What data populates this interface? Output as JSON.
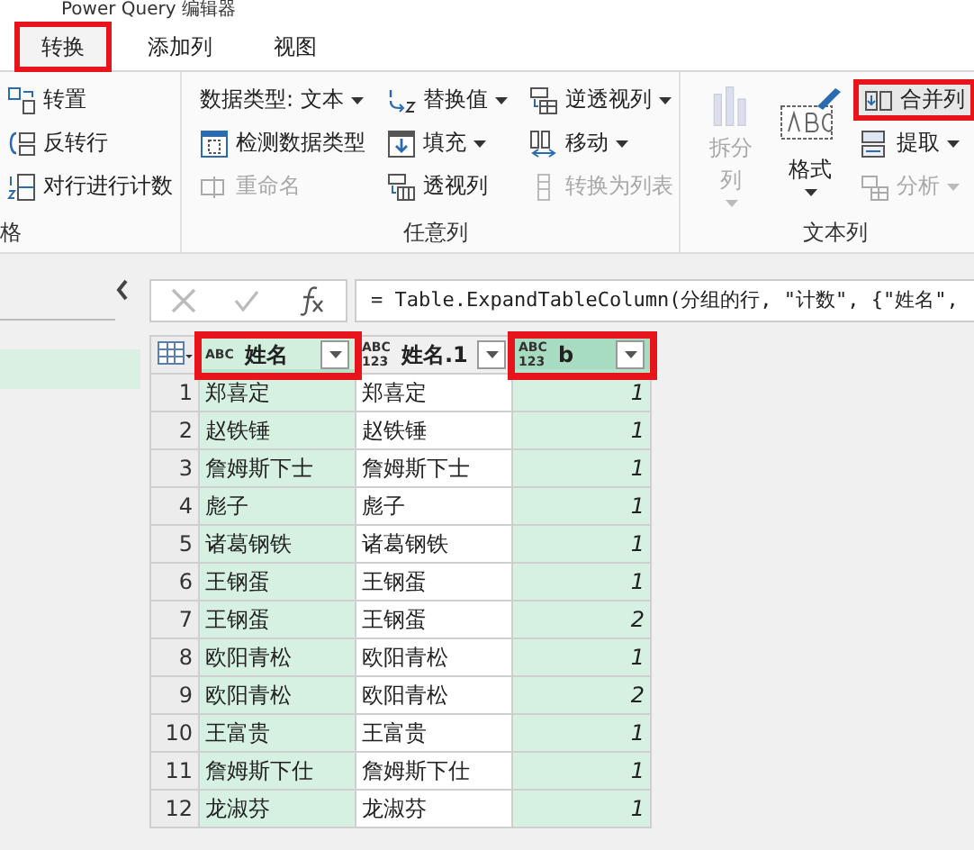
{
  "window": {
    "title": "Power Query 编辑器"
  },
  "tabs": [
    {
      "label": "转换",
      "selected": true,
      "highlighted": true
    },
    {
      "label": "添加列",
      "selected": false,
      "highlighted": false
    },
    {
      "label": "视图",
      "selected": false,
      "highlighted": false
    }
  ],
  "ribbon": {
    "groups": [
      {
        "label": "格",
        "columns": [
          {
            "kind": "small",
            "items": [
              {
                "label": "转置",
                "disabled": false,
                "dropdown": false,
                "highlighted": false
              },
              {
                "label": "反转行",
                "disabled": false,
                "dropdown": false,
                "highlighted": false
              },
              {
                "label": "对行进行计数",
                "disabled": false,
                "dropdown": false,
                "highlighted": false
              }
            ]
          }
        ]
      },
      {
        "label": "任意列",
        "columns": [
          {
            "kind": "small",
            "items": [
              {
                "label": "数据类型: 文本",
                "disabled": false,
                "dropdown": true,
                "highlighted": false
              },
              {
                "label": "检测数据类型",
                "disabled": false,
                "dropdown": false,
                "highlighted": false
              },
              {
                "label": "重命名",
                "disabled": true,
                "dropdown": false,
                "highlighted": false
              }
            ]
          },
          {
            "kind": "small",
            "items": [
              {
                "label": "替换值",
                "disabled": false,
                "dropdown": true,
                "highlighted": false
              },
              {
                "label": "填充",
                "disabled": false,
                "dropdown": true,
                "highlighted": false
              },
              {
                "label": "透视列",
                "disabled": false,
                "dropdown": false,
                "highlighted": false
              }
            ]
          },
          {
            "kind": "small",
            "items": [
              {
                "label": "逆透视列",
                "disabled": false,
                "dropdown": true,
                "highlighted": false
              },
              {
                "label": "移动",
                "disabled": false,
                "dropdown": true,
                "highlighted": false
              },
              {
                "label": "转换为列表",
                "disabled": true,
                "dropdown": false,
                "highlighted": false
              }
            ]
          }
        ]
      },
      {
        "label": "文本列",
        "columns": [
          {
            "kind": "large",
            "items": [
              {
                "label": "拆分列",
                "disabled": true,
                "dropdown": true,
                "highlighted": false
              }
            ]
          },
          {
            "kind": "large",
            "items": [
              {
                "label": "格式",
                "disabled": false,
                "dropdown": true,
                "highlighted": false
              }
            ]
          },
          {
            "kind": "small",
            "items": [
              {
                "label": "合并列",
                "disabled": false,
                "dropdown": false,
                "highlighted": true
              },
              {
                "label": "提取",
                "disabled": false,
                "dropdown": true,
                "highlighted": false
              },
              {
                "label": "分析",
                "disabled": true,
                "dropdown": true,
                "highlighted": false
              }
            ]
          }
        ]
      }
    ]
  },
  "queries": [
    {
      "selected": true
    }
  ],
  "formula_bar": {
    "formula": "= Table.ExpandTableColumn(分组的行, \"计数\", {\"姓名\","
  },
  "table": {
    "columns": [
      {
        "name": "姓名",
        "kind": "text",
        "type_label": "ABC",
        "selected": true,
        "focused": false,
        "highlighted": true
      },
      {
        "name": "姓名.1",
        "kind": "text",
        "type_label": "ABC 123",
        "selected": false,
        "focused": false,
        "highlighted": false
      },
      {
        "name": "b",
        "kind": "number",
        "type_label": "ABC 123",
        "selected": true,
        "focused": true,
        "highlighted": true
      }
    ],
    "rows": [
      {
        "number": "1",
        "cells": [
          "郑喜定",
          "郑喜定",
          "1"
        ]
      },
      {
        "number": "2",
        "cells": [
          "赵铁锤",
          "赵铁锤",
          "1"
        ]
      },
      {
        "number": "3",
        "cells": [
          "詹姆斯下士",
          "詹姆斯下士",
          "1"
        ]
      },
      {
        "number": "4",
        "cells": [
          "彪子",
          "彪子",
          "1"
        ]
      },
      {
        "number": "5",
        "cells": [
          "诸葛钢铁",
          "诸葛钢铁",
          "1"
        ]
      },
      {
        "number": "6",
        "cells": [
          "王钢蛋",
          "王钢蛋",
          "1"
        ]
      },
      {
        "number": "7",
        "cells": [
          "王钢蛋",
          "王钢蛋",
          "2"
        ]
      },
      {
        "number": "8",
        "cells": [
          "欧阳青松",
          "欧阳青松",
          "1"
        ]
      },
      {
        "number": "9",
        "cells": [
          "欧阳青松",
          "欧阳青松",
          "2"
        ]
      },
      {
        "number": "10",
        "cells": [
          "王富贵",
          "王富贵",
          "1"
        ]
      },
      {
        "number": "11",
        "cells": [
          "詹姆斯下仕",
          "詹姆斯下仕",
          "1"
        ]
      },
      {
        "number": "12",
        "cells": [
          "龙淑芬",
          "龙淑芬",
          "1"
        ]
      }
    ]
  }
}
